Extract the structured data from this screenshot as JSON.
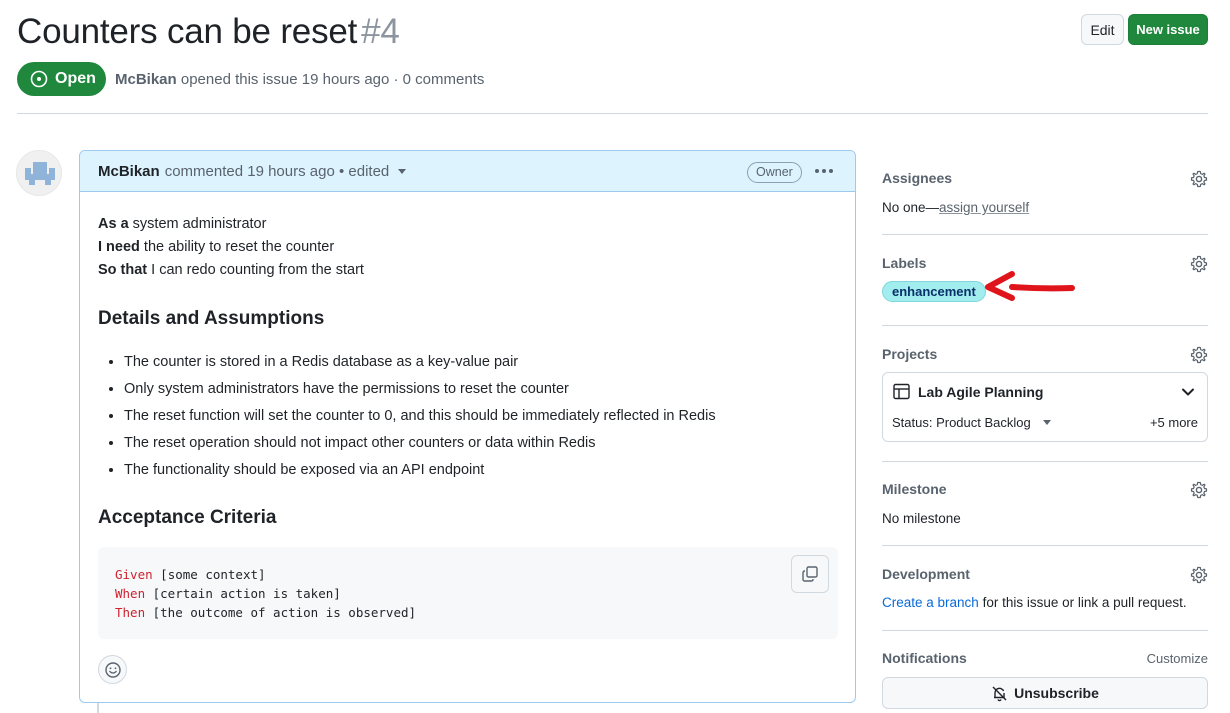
{
  "issue": {
    "title": "Counters can be reset",
    "number": "#4",
    "state": "Open",
    "author": "McBikan",
    "meta": "opened this issue 19 hours ago · 0 comments"
  },
  "header": {
    "edit_label": "Edit",
    "new_issue_label": "New issue"
  },
  "comment": {
    "author": "McBikan",
    "meta": "commented 19 hours ago • edited",
    "role_badge": "Owner",
    "story": [
      {
        "kw": "As a",
        "text": " system administrator"
      },
      {
        "kw": "I need",
        "text": " the ability to reset the counter"
      },
      {
        "kw": "So that",
        "text": " I can redo counting from the start"
      }
    ],
    "details_heading": "Details and Assumptions",
    "details": [
      "The counter is stored in a Redis database as a key-value pair",
      "Only system administrators have the permissions to reset the counter",
      "The reset function will set the counter to 0, and this should be immediately reflected in Redis",
      "The reset operation should not impact other counters or data within Redis",
      "The functionality should be exposed via an API endpoint"
    ],
    "acceptance_heading": "Acceptance Criteria",
    "code": [
      {
        "kw": "Given",
        "text": " [some context]"
      },
      {
        "kw": "When",
        "text": " [certain action is taken]"
      },
      {
        "kw": "Then",
        "text": " [the outcome of action is observed]"
      }
    ]
  },
  "sidebar": {
    "assignees": {
      "title": "Assignees",
      "value": "No one—",
      "link": "assign yourself"
    },
    "labels": {
      "title": "Labels",
      "label": "enhancement",
      "label_color": "#a2eeef"
    },
    "projects": {
      "title": "Projects",
      "project_name": "Lab Agile Planning",
      "status": "Status: Product Backlog",
      "more": "+5 more"
    },
    "milestone": {
      "title": "Milestone",
      "value": "No milestone"
    },
    "development": {
      "title": "Development",
      "link": "Create a branch",
      "text": " for this issue or link a pull request."
    },
    "notifications": {
      "title": "Notifications",
      "customize": "Customize",
      "button": "Unsubscribe"
    }
  },
  "colors": {
    "accent_green": "#1f883d",
    "link_blue": "#0969da",
    "annotation_arrow": "#e0141b"
  }
}
